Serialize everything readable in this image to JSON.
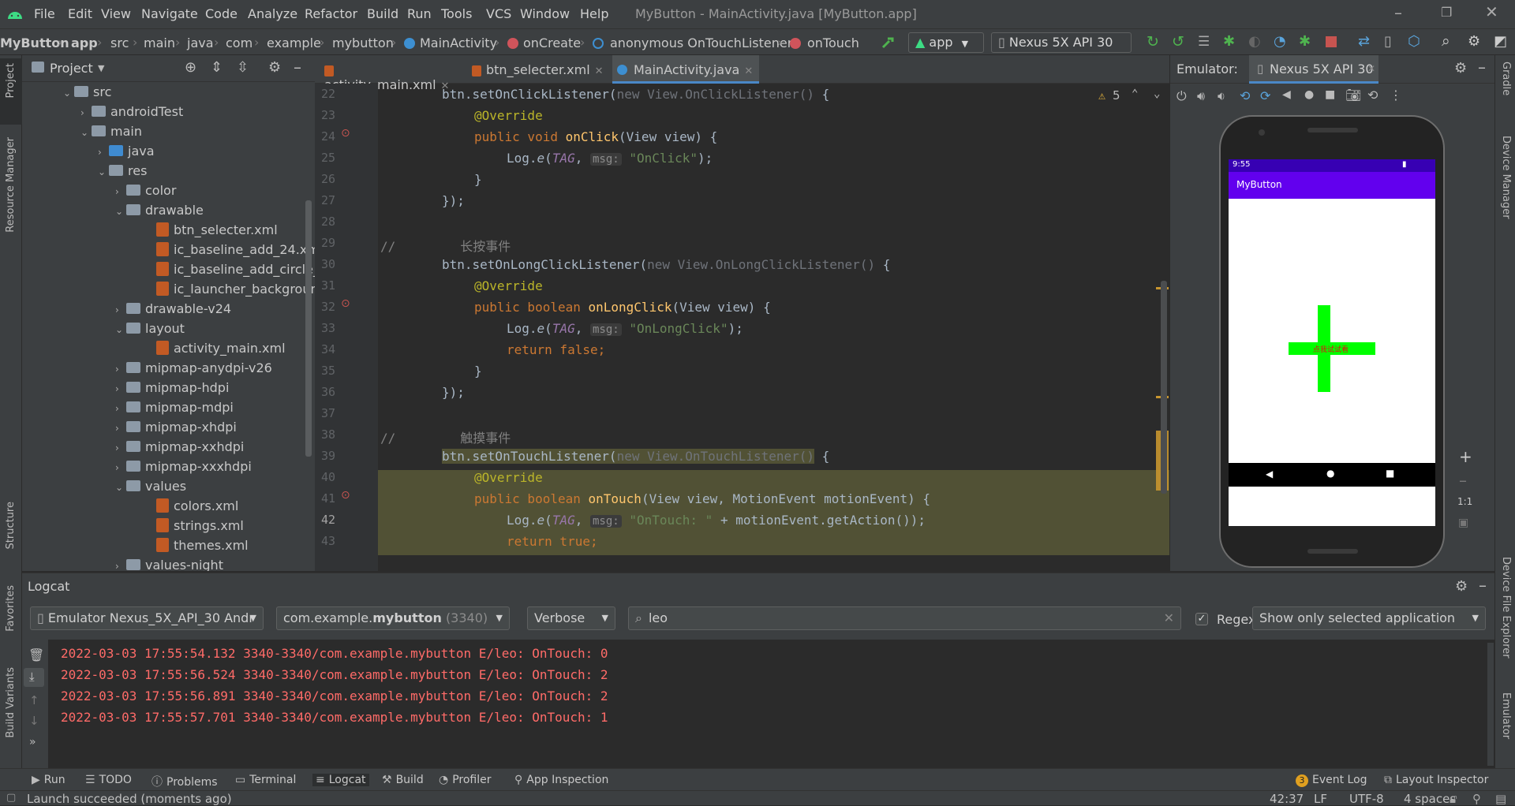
{
  "menu": [
    "File",
    "Edit",
    "View",
    "Navigate",
    "Code",
    "Analyze",
    "Refactor",
    "Build",
    "Run",
    "Tools",
    "VCS",
    "Window",
    "Help"
  ],
  "window_title": "MyButton - MainActivity.java [MyButton.app]",
  "breadcrumb": [
    "MyButton",
    "app",
    "src",
    "main",
    "java",
    "com",
    "example",
    "mybutton",
    "MainActivity",
    "onCreate",
    "anonymous OnTouchListener",
    "onTouch"
  ],
  "toolbar": {
    "run_config": "app",
    "device": "Nexus 5X API 30"
  },
  "project_panel": {
    "title": "Project"
  },
  "tree": [
    {
      "label": "src",
      "type": "folder",
      "open": true
    },
    {
      "label": "androidTest",
      "type": "folder",
      "open": false
    },
    {
      "label": "main",
      "type": "folder",
      "open": true
    },
    {
      "label": "java",
      "type": "folder-blue",
      "open": false
    },
    {
      "label": "res",
      "type": "folder",
      "open": true
    },
    {
      "label": "color",
      "type": "folder",
      "open": false
    },
    {
      "label": "drawable",
      "type": "folder",
      "open": true
    },
    {
      "label": "btn_selecter.xml",
      "type": "xml"
    },
    {
      "label": "ic_baseline_add_24.xml",
      "type": "xml"
    },
    {
      "label": "ic_baseline_add_circle_ou",
      "type": "xml"
    },
    {
      "label": "ic_launcher_background.x",
      "type": "xml"
    },
    {
      "label": "drawable-v24",
      "type": "folder",
      "open": false
    },
    {
      "label": "layout",
      "type": "folder",
      "open": true
    },
    {
      "label": "activity_main.xml",
      "type": "xml"
    },
    {
      "label": "mipmap-anydpi-v26",
      "type": "folder",
      "open": false
    },
    {
      "label": "mipmap-hdpi",
      "type": "folder",
      "open": false
    },
    {
      "label": "mipmap-mdpi",
      "type": "folder",
      "open": false
    },
    {
      "label": "mipmap-xhdpi",
      "type": "folder",
      "open": false
    },
    {
      "label": "mipmap-xxhdpi",
      "type": "folder",
      "open": false
    },
    {
      "label": "mipmap-xxxhdpi",
      "type": "folder",
      "open": false
    },
    {
      "label": "values",
      "type": "folder",
      "open": true
    },
    {
      "label": "colors.xml",
      "type": "xml"
    },
    {
      "label": "strings.xml",
      "type": "xml"
    },
    {
      "label": "themes.xml",
      "type": "xml"
    },
    {
      "label": "values-night",
      "type": "folder",
      "open": false
    }
  ],
  "editor_tabs": [
    "activity_main.xml",
    "btn_selecter.xml",
    "MainActivity.java"
  ],
  "active_tab": "MainActivity.java",
  "warnings_count": "5",
  "line_numbers": [
    "22",
    "23",
    "24",
    "25",
    "26",
    "27",
    "28",
    "29",
    "30",
    "31",
    "32",
    "33",
    "34",
    "35",
    "36",
    "37",
    "38",
    "39",
    "40",
    "41",
    "42",
    "43"
  ],
  "code": {
    "l22a": "btn.setOnClickListener(",
    "l22b": "new View.OnClickListener()",
    "l22c": " {",
    "ann": "@Override",
    "l24a": "public void ",
    "l24b": "onClick",
    "l24c": "(View view) {",
    "log": "Log.",
    "loge": "e",
    "tag": "TAG",
    "msg": "msg:",
    "s_onclick": "\"OnClick\"",
    "close_paren": ");",
    "brace": "}",
    "brace_paren": "});",
    "comment_slash": "//",
    "c_longpress": "长按事件",
    "l30a": "btn.setOnLongClickListener(",
    "l30b": "new View.OnLongClickListener()",
    "l32a": "public boolean ",
    "l32b": "onLongClick",
    "l32c": "(View view) {",
    "s_onlong": "\"OnLongClick\"",
    "ret_false": "return false;",
    "c_touch": "触摸事件",
    "l39a": "btn.setOnTouchListener(",
    "l39b": "new View.OnTouchListener()",
    "l41b": "onTouch",
    "l41c": "(View view, MotionEvent motionEvent) {",
    "s_ontouch": "\"OnTouch: \"",
    "l42c": " + motionEvent.getAction());",
    "ret_true": "return true;"
  },
  "emulator": {
    "label": "Emulator:",
    "device_tab": "Nexus 5X API 30",
    "status_time": "9:55",
    "app_title": "MyButton",
    "button_text": "点我试试看",
    "zoom_1to1": "1:1"
  },
  "logcat": {
    "title": "Logcat",
    "device": "Emulator Nexus_5X_API_30 Andr",
    "process_pkg_prefix": "com.example.",
    "process_pkg_bold": "mybutton",
    "process_pid": "(3340)",
    "level": "Verbose",
    "search": "leo",
    "regex_label": "Regex",
    "regex_checked": true,
    "filter": "Show only selected application",
    "lines": [
      "2022-03-03 17:55:54.132 3340-3340/com.example.mybutton E/leo: OnTouch: 0",
      "2022-03-03 17:55:56.524 3340-3340/com.example.mybutton E/leo: OnTouch: 2",
      "2022-03-03 17:55:56.891 3340-3340/com.example.mybutton E/leo: OnTouch: 2",
      "2022-03-03 17:55:57.701 3340-3340/com.example.mybutton E/leo: OnTouch: 1"
    ]
  },
  "left_tool_windows": [
    "Project",
    "Resource Manager",
    "Structure",
    "Favorites",
    "Build Variants"
  ],
  "right_tool_windows": [
    "Gradle",
    "Device Manager",
    "Device File Explorer",
    "Emulator"
  ],
  "bottom_tools": [
    "Run",
    "TODO",
    "Problems",
    "Terminal",
    "Logcat",
    "Build",
    "Profiler",
    "App Inspection"
  ],
  "bottom_right_tools": {
    "event_log_count": "3",
    "event_log": "Event Log",
    "layout_inspector": "Layout Inspector"
  },
  "status": {
    "message": "Launch succeeded (moments ago)",
    "position": "42:37",
    "line_sep": "LF",
    "encoding": "UTF-8",
    "indent": "4 spaces"
  },
  "colors": {
    "accent": "#4a88c7",
    "app_bar": "#6200ee",
    "button_green": "#00ff00",
    "log_error": "#ff6b68",
    "highlight": "#515135"
  }
}
